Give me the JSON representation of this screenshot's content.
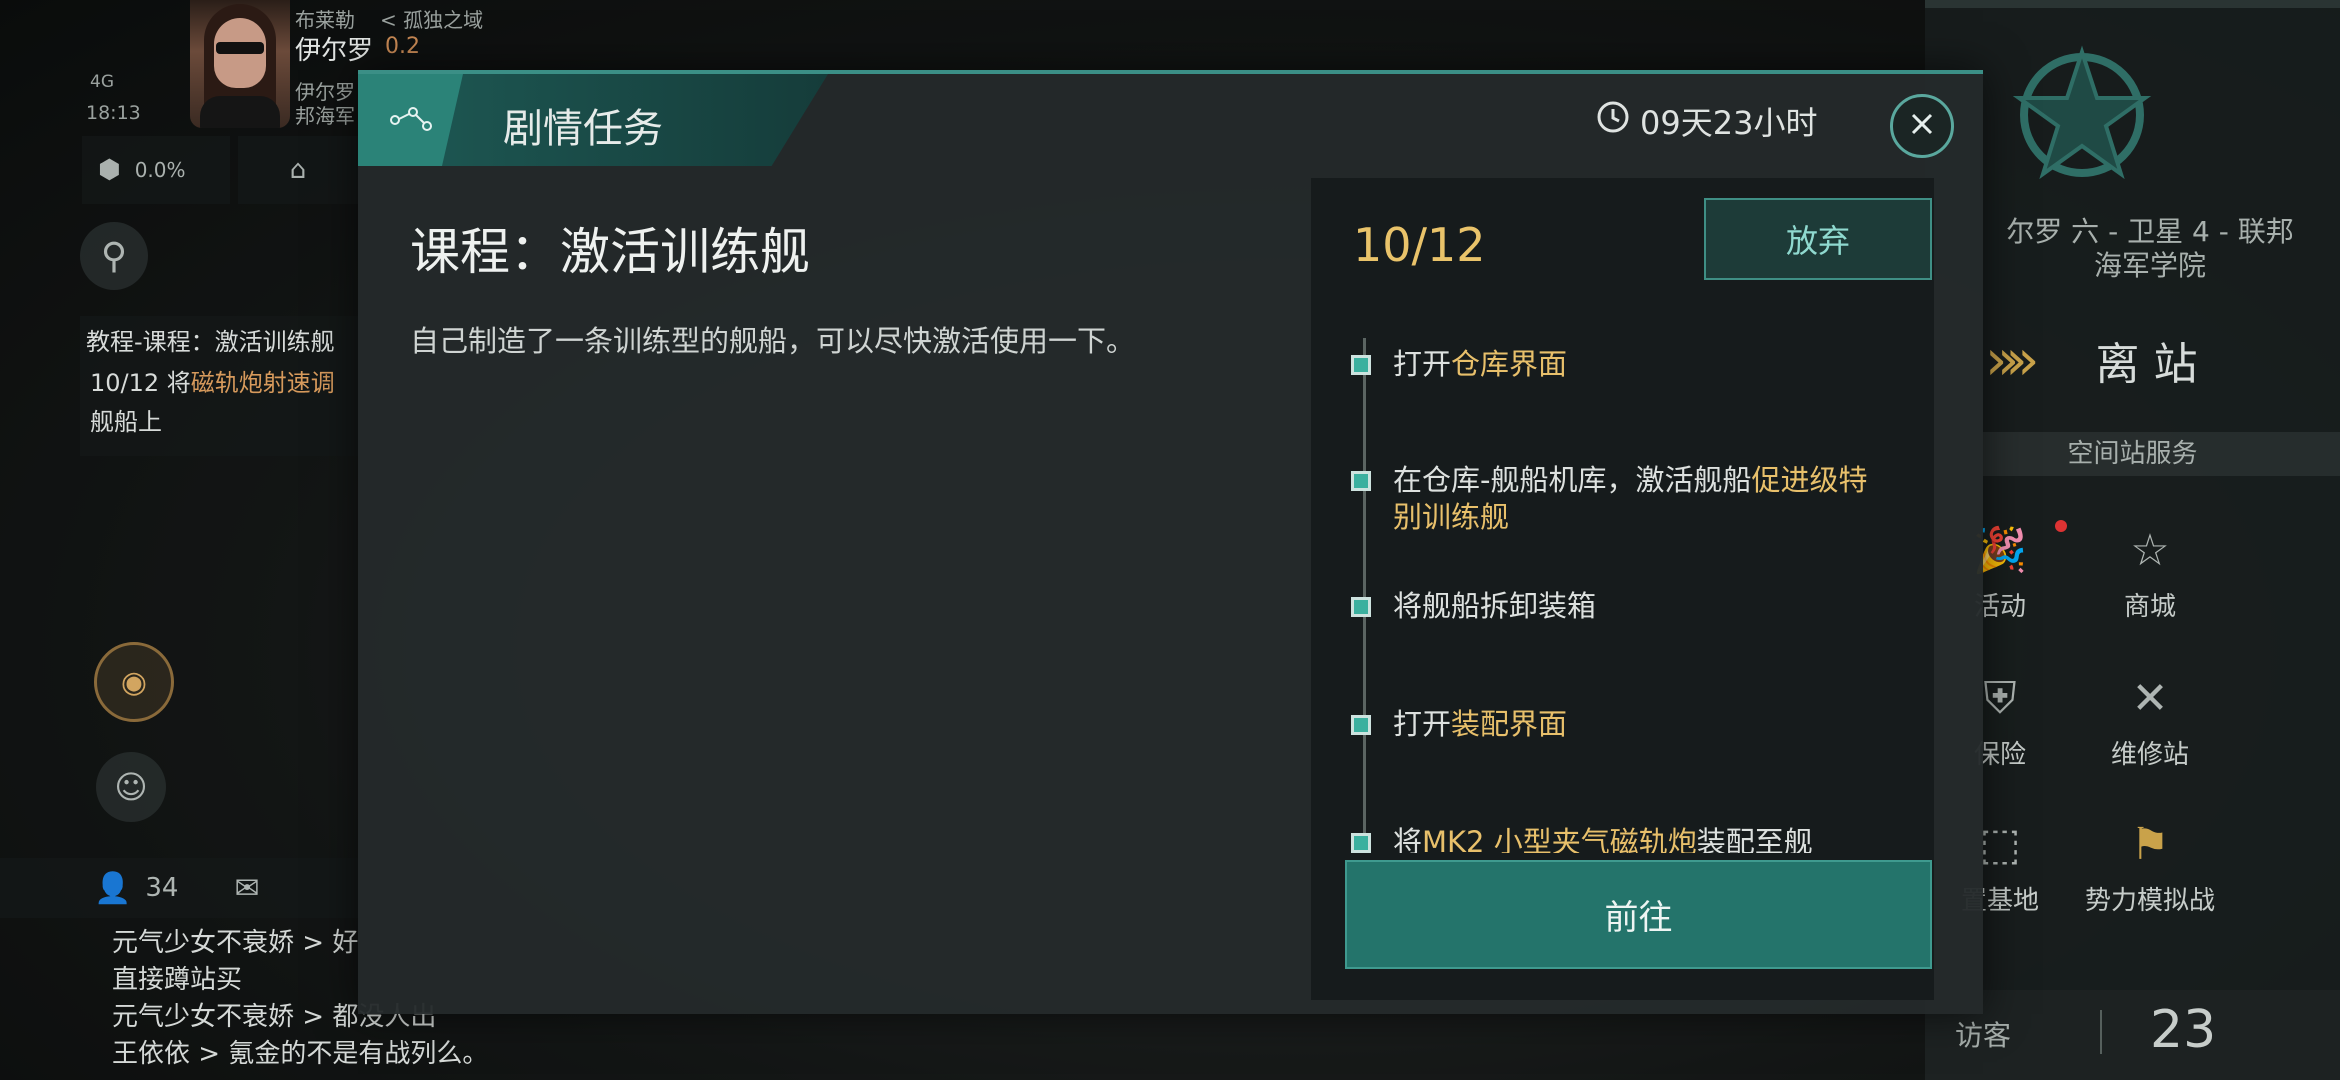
{
  "status": {
    "player_region": "布莱勒",
    "breadcrumb": "< 孤独之域",
    "system_name": "伊尔罗",
    "security": "0.2",
    "network": "4G",
    "time": "18:13",
    "location_partial_1": "伊尔罗",
    "location_partial_2": "邦海军",
    "cargo_percent": "0.0%"
  },
  "tracker": {
    "title": "教程-课程：激活训练舰",
    "progress_prefix": "10/12 将",
    "progress_highlight": "磁轨炮射速调",
    "progress_suffix": "舰船上"
  },
  "social": {
    "online_count": "34"
  },
  "chat": [
    {
      "name": "元气少女不衰娇",
      "text": "> 好"
    },
    {
      "name": "",
      "text": "直接蹲站买"
    },
    {
      "name": "元气少女不衰娇",
      "text": "> 都没人出"
    },
    {
      "name": "王依依",
      "text": "> 氪金的不是有战列么。"
    }
  ],
  "station": {
    "name": "尔罗 六 - 卫星 4 - 联邦",
    "name_line2": "海军学院",
    "undock": "离 站",
    "services_title": "空间站服务",
    "services": [
      {
        "label": "活动",
        "icon": "party-popper-icon"
      },
      {
        "label": "商城",
        "icon": "mall-star-icon"
      },
      {
        "label": "保险",
        "icon": "insurance-icon"
      },
      {
        "label": "维修站",
        "icon": "repair-tools-icon"
      },
      {
        "label": "置基地",
        "icon": "base-icon"
      },
      {
        "label": "势力模拟战",
        "icon": "faction-flags-icon"
      }
    ],
    "visitors_label": "访客",
    "visitors_count": "23"
  },
  "dialog": {
    "tab_title": "剧情任务",
    "timer": "09天23小时",
    "quest_title": "课程：激活训练舰",
    "quest_desc": "自己制造了一条训练型的舰船，可以尽快激活使用一下。",
    "progress": "10/12",
    "abandon_label": "放弃",
    "go_label": "前往",
    "steps": [
      {
        "pre": "打开",
        "hl": "仓库界面",
        "post": ""
      },
      {
        "pre": "在仓库-舰船机库，激活舰船",
        "hl": "促进级特别训练舰",
        "post": ""
      },
      {
        "pre": "将舰船拆卸装箱",
        "hl": "",
        "post": ""
      },
      {
        "pre": "打开",
        "hl": "装配界面",
        "post": ""
      },
      {
        "pre": "将",
        "hl": "MK2 小型夹气磁轨炮",
        "post": "装配至舰"
      }
    ]
  },
  "colors": {
    "accent": "#3bb09f",
    "highlight": "#e8c06b",
    "button": "#24746b"
  }
}
